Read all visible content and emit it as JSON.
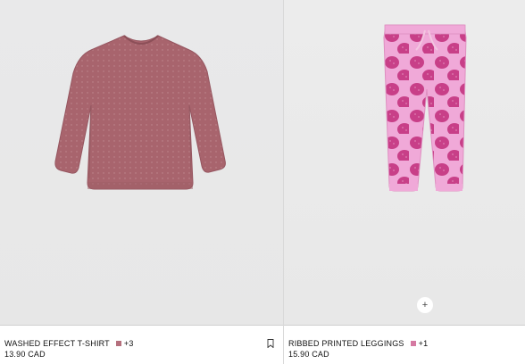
{
  "products": [
    {
      "name": "WASHED EFFECT T-SHIRT",
      "color_swatch": "#b5707d",
      "more_colors": "+3",
      "price": "13.90 CAD",
      "image_icon": "long-sleeve-tshirt-image",
      "bookmark_icon": "bookmark-icon"
    },
    {
      "name": "RIBBED PRINTED LEGGINGS",
      "color_swatch": "#d57aa2",
      "more_colors": "+1",
      "price": "15.90 CAD",
      "image_icon": "strawberry-leggings-image",
      "quick_add_label": "+"
    }
  ],
  "colors": {
    "tshirt": "#a8646d",
    "leggings_base": "#f0a9d8",
    "strawberry": "#c83f88"
  }
}
